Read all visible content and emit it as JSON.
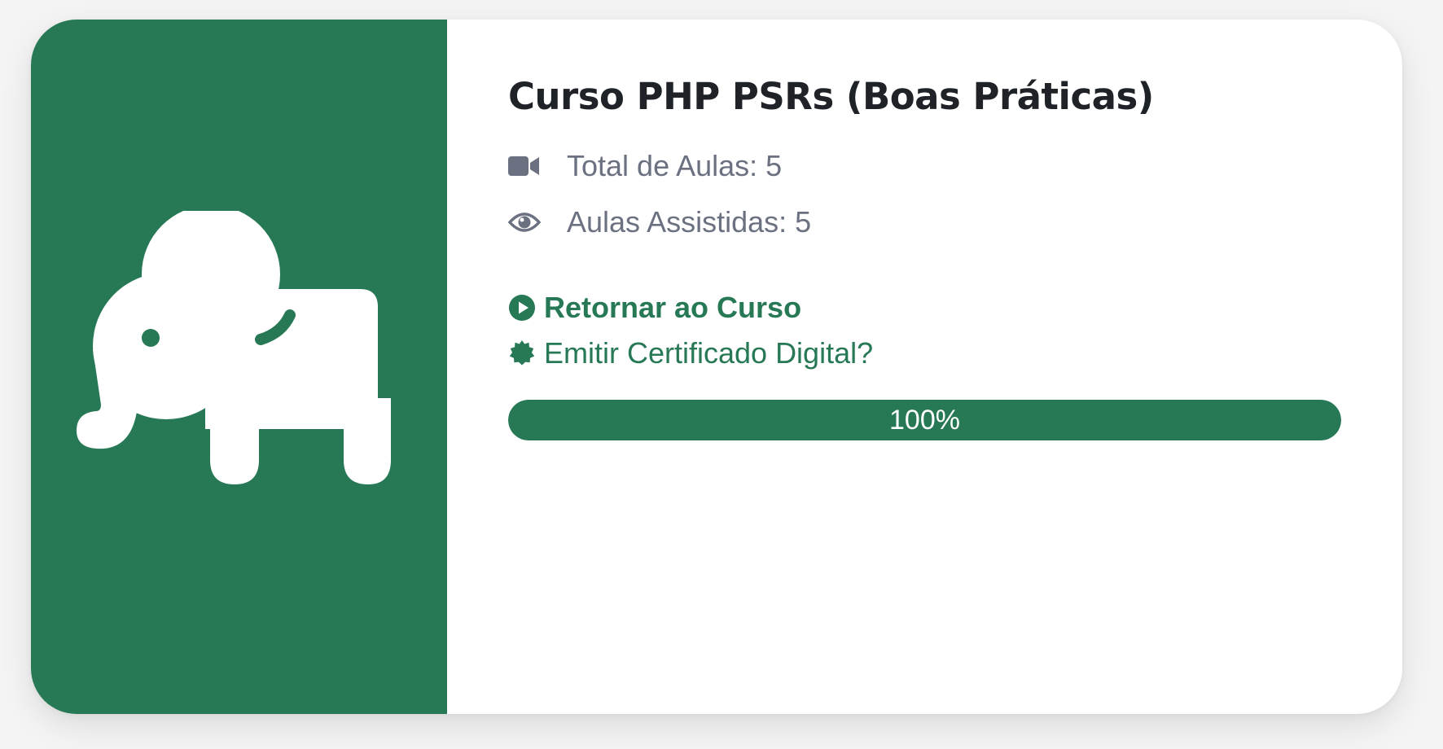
{
  "course": {
    "title": "Curso PHP PSRs (Boas Práticas)",
    "thumbnail_icon": "elephant-icon",
    "thumbnail_color": "#277956"
  },
  "stats": {
    "total_lessons": "Total de Aulas: 5",
    "total_lessons_icon": "video-camera-icon",
    "watched_lessons": "Aulas Assistidas: 5",
    "watched_lessons_icon": "eye-icon"
  },
  "actions": {
    "return_label": "Retornar ao Curso",
    "return_icon": "play-circle-icon",
    "certificate_label": "Emitir Certificado Digital?",
    "certificate_icon": "certificate-icon"
  },
  "progress": {
    "value": 100,
    "label": "100%"
  },
  "colors": {
    "brand": "#277956",
    "muted_text": "#6b7180",
    "title_text": "#1f2328"
  }
}
